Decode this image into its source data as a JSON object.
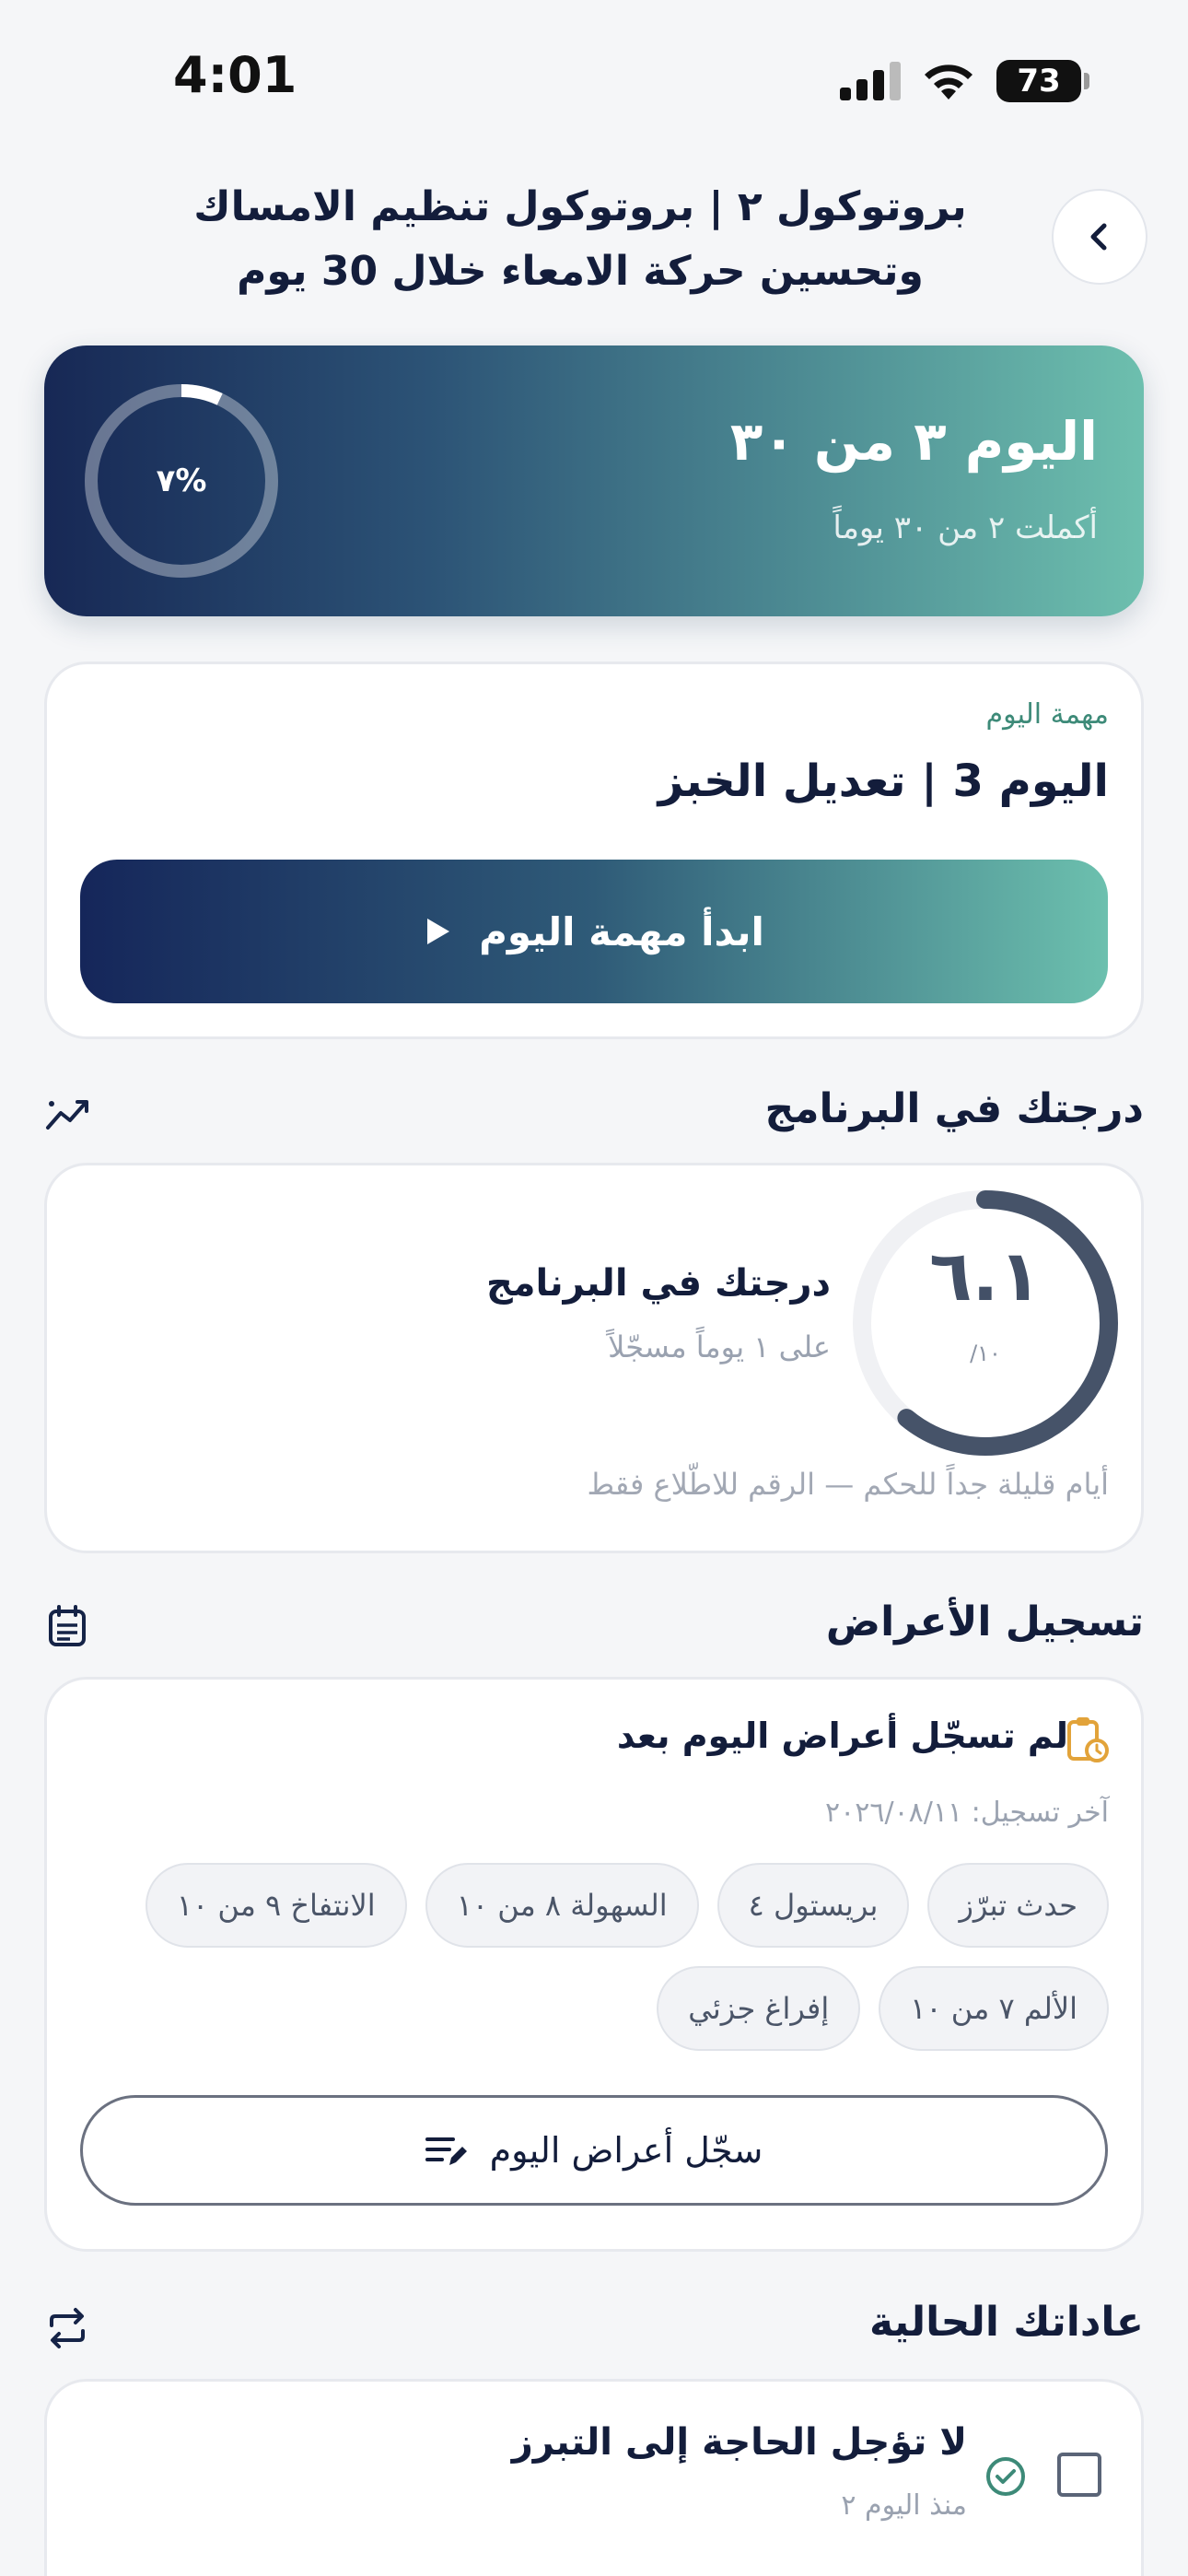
{
  "status_bar": {
    "time": "4:01",
    "battery": "73"
  },
  "header": {
    "title": "بروتوكول ٢ | بروتوكول تنظيم الامساك وتحسين حركة الامعاء خلال 30 يوم"
  },
  "progress": {
    "title": "اليوم ٣ من ٣٠",
    "subtitle": "أكملت ٢ من ٣٠ يوماً",
    "percent_label": "%٧",
    "percent": 7
  },
  "task": {
    "label": "مهمة اليوم",
    "title": "اليوم 3 | تعديل الخبز",
    "button": "ابدأ مهمة اليوم"
  },
  "score": {
    "section_title": "درجتك في البرنامج",
    "value": "٦.١",
    "max": "١٠/",
    "value_num": 6.1,
    "max_num": 10,
    "title": "درجتك في البرنامج",
    "subtitle": "على ١ يوماً مسجّلاً",
    "note": "أيام قليلة جداً للحكم — الرقم للاطّلاع فقط"
  },
  "symptoms": {
    "section_title": "تسجيل الأعراض",
    "status": "لم تسجّل أعراض اليوم بعد",
    "last_logged": "آخر تسجيل: ٢٠٢٦/٠٨/١١",
    "chips_row1": [
      "حدث تبرّز",
      "بريستول ٤",
      "السهولة ٨ من ١٠",
      "الانتفاخ ٩ من ١٠"
    ],
    "chips_row2": [
      "الألم ٧ من ١٠",
      "إفراغ جزئي"
    ],
    "button": "سجّل أعراض اليوم"
  },
  "habits": {
    "section_title": "عاداتك الحالية",
    "items": [
      {
        "title": "لا تؤجل الحاجة إلى التبرز",
        "since": "منذ اليوم ٢"
      }
    ]
  },
  "colors": {
    "navy": "#15265a",
    "teal": "#6cc0ae",
    "accent_green": "#3d8a78",
    "amber": "#e2a33a"
  }
}
